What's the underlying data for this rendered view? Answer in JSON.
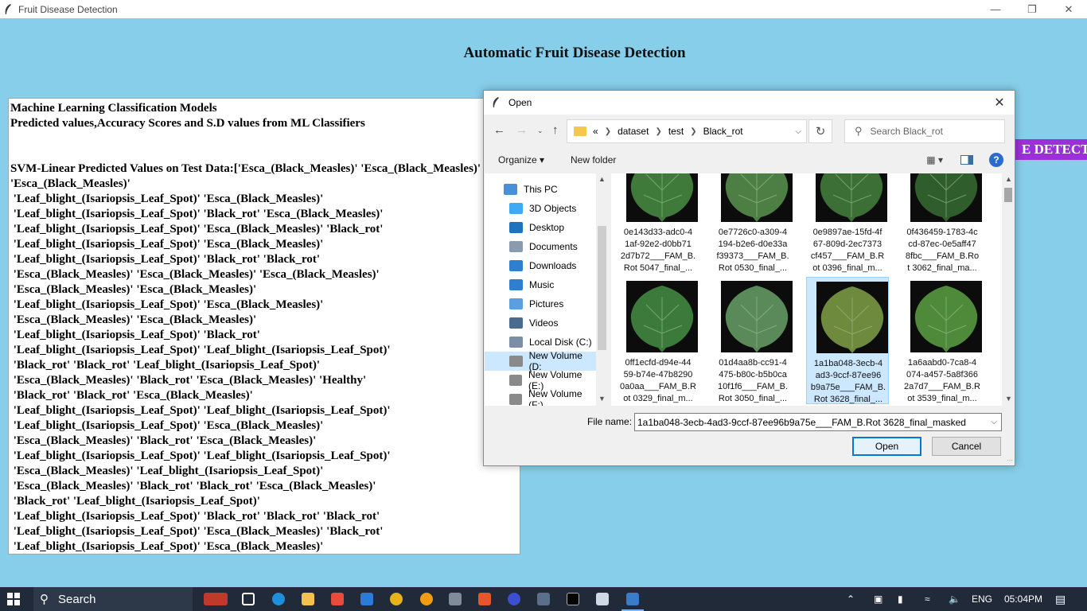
{
  "app": {
    "window_title": "Fruit Disease Detection",
    "heading": "Automatic Fruit Disease Detection",
    "detect_button": "E DETECT"
  },
  "output": {
    "lines": [
      "Machine Learning Classification Models",
      "Predicted values,Accuracy Scores and S.D values from ML Classifiers",
      "",
      "",
      "SVM-Linear Predicted Values on Test Data:['Esca_(Black_Measles)' 'Esca_(Black_Measles)'",
      "'Esca_(Black_Measles)'",
      " 'Leaf_blight_(Isariopsis_Leaf_Spot)' 'Esca_(Black_Measles)'",
      " 'Leaf_blight_(Isariopsis_Leaf_Spot)' 'Black_rot' 'Esca_(Black_Measles)'",
      " 'Leaf_blight_(Isariopsis_Leaf_Spot)' 'Esca_(Black_Measles)' 'Black_rot'",
      " 'Leaf_blight_(Isariopsis_Leaf_Spot)' 'Esca_(Black_Measles)'",
      " 'Leaf_blight_(Isariopsis_Leaf_Spot)' 'Black_rot' 'Black_rot'",
      " 'Esca_(Black_Measles)' 'Esca_(Black_Measles)' 'Esca_(Black_Measles)'",
      " 'Esca_(Black_Measles)' 'Esca_(Black_Measles)'",
      " 'Leaf_blight_(Isariopsis_Leaf_Spot)' 'Esca_(Black_Measles)'",
      " 'Esca_(Black_Measles)' 'Esca_(Black_Measles)'",
      " 'Leaf_blight_(Isariopsis_Leaf_Spot)' 'Black_rot'",
      " 'Leaf_blight_(Isariopsis_Leaf_Spot)' 'Leaf_blight_(Isariopsis_Leaf_Spot)'",
      " 'Black_rot' 'Black_rot' 'Leaf_blight_(Isariopsis_Leaf_Spot)'",
      " 'Esca_(Black_Measles)' 'Black_rot' 'Esca_(Black_Measles)' 'Healthy'",
      " 'Black_rot' 'Black_rot' 'Esca_(Black_Measles)'",
      " 'Leaf_blight_(Isariopsis_Leaf_Spot)' 'Leaf_blight_(Isariopsis_Leaf_Spot)'",
      " 'Leaf_blight_(Isariopsis_Leaf_Spot)' 'Esca_(Black_Measles)'",
      " 'Esca_(Black_Measles)' 'Black_rot' 'Esca_(Black_Measles)'",
      " 'Leaf_blight_(Isariopsis_Leaf_Spot)' 'Leaf_blight_(Isariopsis_Leaf_Spot)'",
      " 'Esca_(Black_Measles)' 'Leaf_blight_(Isariopsis_Leaf_Spot)'",
      " 'Esca_(Black_Measles)' 'Black_rot' 'Black_rot' 'Esca_(Black_Measles)'",
      " 'Black_rot' 'Leaf_blight_(Isariopsis_Leaf_Spot)'",
      " 'Leaf_blight_(Isariopsis_Leaf_Spot)' 'Black_rot' 'Black_rot' 'Black_rot'",
      " 'Leaf_blight_(Isariopsis_Leaf_Spot)' 'Esca_(Black_Measles)' 'Black_rot'",
      " 'Leaf_blight_(Isariopsis_Leaf_Spot)' 'Esca_(Black_Measles)'"
    ]
  },
  "dialog": {
    "title": "Open",
    "breadcrumb": {
      "overflow": "«",
      "parts": [
        "dataset",
        "test",
        "Black_rot"
      ]
    },
    "search_placeholder": "Search Black_rot",
    "organize_label": "Organize ▾",
    "new_folder_label": "New folder",
    "nav_items": [
      {
        "label": "This PC",
        "color": "#4a90d9",
        "selected": false
      },
      {
        "label": "3D Objects",
        "color": "#3fa9f5",
        "selected": false
      },
      {
        "label": "Desktop",
        "color": "#1e73be",
        "selected": false
      },
      {
        "label": "Documents",
        "color": "#8a9bb0",
        "selected": false
      },
      {
        "label": "Downloads",
        "color": "#2f7fd0",
        "selected": false
      },
      {
        "label": "Music",
        "color": "#2f7fd0",
        "selected": false
      },
      {
        "label": "Pictures",
        "color": "#5aa0e0",
        "selected": false
      },
      {
        "label": "Videos",
        "color": "#4a6a90",
        "selected": false
      },
      {
        "label": "Local Disk (C:)",
        "color": "#7b8ea5",
        "selected": false
      },
      {
        "label": "New Volume (D:",
        "color": "#8a8a8a",
        "selected": true
      },
      {
        "label": "New Volume (E:)",
        "color": "#8a8a8a",
        "selected": false
      },
      {
        "label": "New Volume (F:)",
        "color": "#8a8a8a",
        "selected": false
      }
    ],
    "files": [
      {
        "caption": "0e143d33-adc0-4\n1af-92e2-d0bb71\n2d7b72___FAM_B.\nRot 5047_final_...",
        "leaf": "#3f7a3a",
        "selected": false
      },
      {
        "caption": "0e7726c0-a309-4\n194-b2e6-d0e33a\nf39373___FAM_B.\nRot 0530_final_...",
        "leaf": "#4d7f45",
        "selected": false
      },
      {
        "caption": "0e9897ae-15fd-4f\n67-809d-2ec7373\ncf457___FAM_B.R\not 0396_final_m...",
        "leaf": "#3b6f36",
        "selected": false
      },
      {
        "caption": "0f436459-1783-4c\ncd-87ec-0e5aff47\n8fbc___FAM_B.Ro\nt 3062_final_ma...",
        "leaf": "#2f5e2c",
        "selected": false
      },
      {
        "caption": "0ff1ecfd-d94e-44\n59-b74e-47b8290\n0a0aa___FAM_B.R\not 0329_final_m...",
        "leaf": "#3c7a3c",
        "selected": false
      },
      {
        "caption": "01d4aa8b-cc91-4\n475-b80c-b5b0ca\n10f1f6___FAM_B.\nRot 3050_final_...",
        "leaf": "#5a8a5a",
        "selected": false
      },
      {
        "caption": "1a1ba048-3ecb-4\nad3-9ccf-87ee96\nb9a75e___FAM_B.\nRot 3628_final_...",
        "leaf": "#6e8a3c",
        "selected": true
      },
      {
        "caption": "1a6aabd0-7ca8-4\n074-a457-5a8f366\n2a7d7___FAM_B.R\not 3539_final_m...",
        "leaf": "#4f8a3a",
        "selected": false
      }
    ],
    "file_name_label": "File name:",
    "file_name_value": "1a1ba048-3ecb-4ad3-9ccf-87ee96b9a75e___FAM_B.Rot 3628_final_masked",
    "open_button": "Open",
    "cancel_button": "Cancel"
  },
  "taskbar": {
    "search_label": "Search",
    "language": "ENG",
    "time": "05:04PM"
  }
}
